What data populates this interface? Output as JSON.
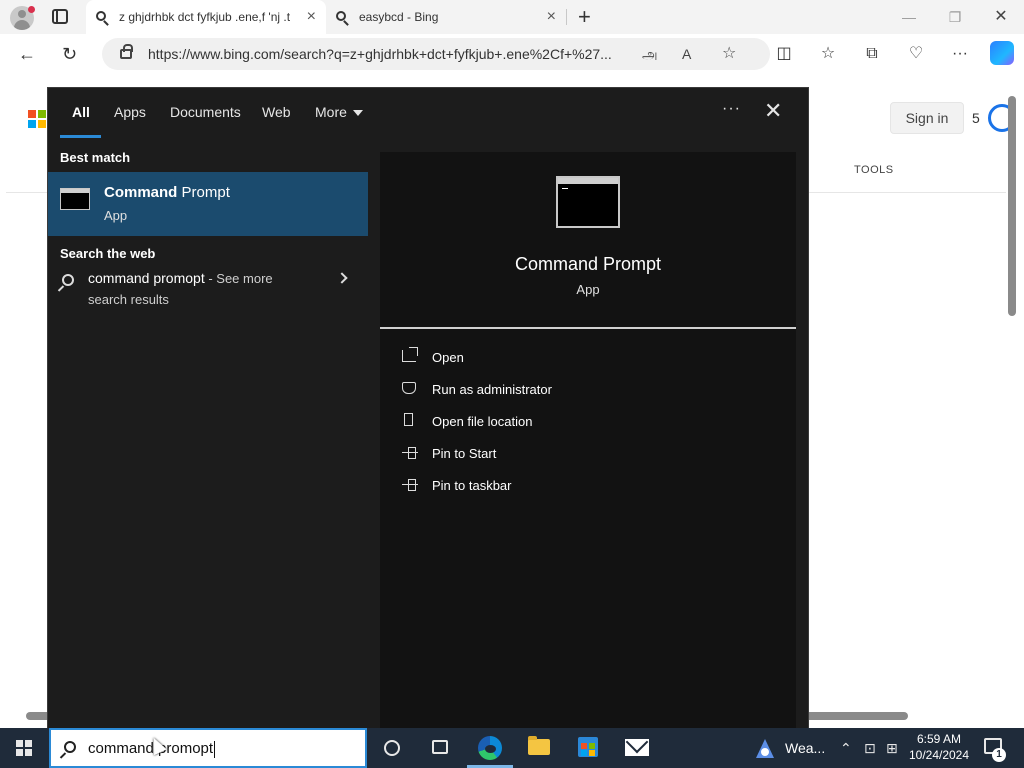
{
  "browser": {
    "tabs": [
      {
        "title": "z ghjdrhbk dct fyfkjub .ene,f 'nj .t",
        "active": true
      },
      {
        "title": "easybcd - Bing",
        "active": false
      }
    ],
    "url": "https://www.bing.com/search?q=z+ghjdrhbk+dct+fyfkjub+.ene%2Cf+%27...",
    "close_glyph": "×",
    "new_tab_glyph": "+"
  },
  "bing": {
    "signin_label": "Sign in",
    "points": "5",
    "tools_label": "TOOLS",
    "logo_colors": [
      "#f25022",
      "#7fba00",
      "#00a4ef",
      "#ffb900"
    ]
  },
  "search_panel": {
    "filters": [
      "All",
      "Apps",
      "Documents",
      "Web",
      "More"
    ],
    "active_filter": "All",
    "more_options_glyph": "···",
    "close_glyph": "✕",
    "best_match_header": "Best match",
    "best_match": {
      "title_bold": "Command",
      "title_rest": " Prompt",
      "subtitle": "App"
    },
    "search_web_header": "Search the web",
    "web_result": {
      "query": "command promopt",
      "suffix": " - See more",
      "line2": "search results"
    },
    "detail": {
      "title": "Command Prompt",
      "subtitle": "App",
      "actions": [
        "Open",
        "Run as administrator",
        "Open file location",
        "Pin to Start",
        "Pin to taskbar"
      ]
    }
  },
  "taskbar": {
    "search_text": "command promopt",
    "weather_label": "Wea...",
    "time": "6:59 AM",
    "date": "10/24/2024",
    "notification_count": "1",
    "accent": "#2b8ad6"
  }
}
